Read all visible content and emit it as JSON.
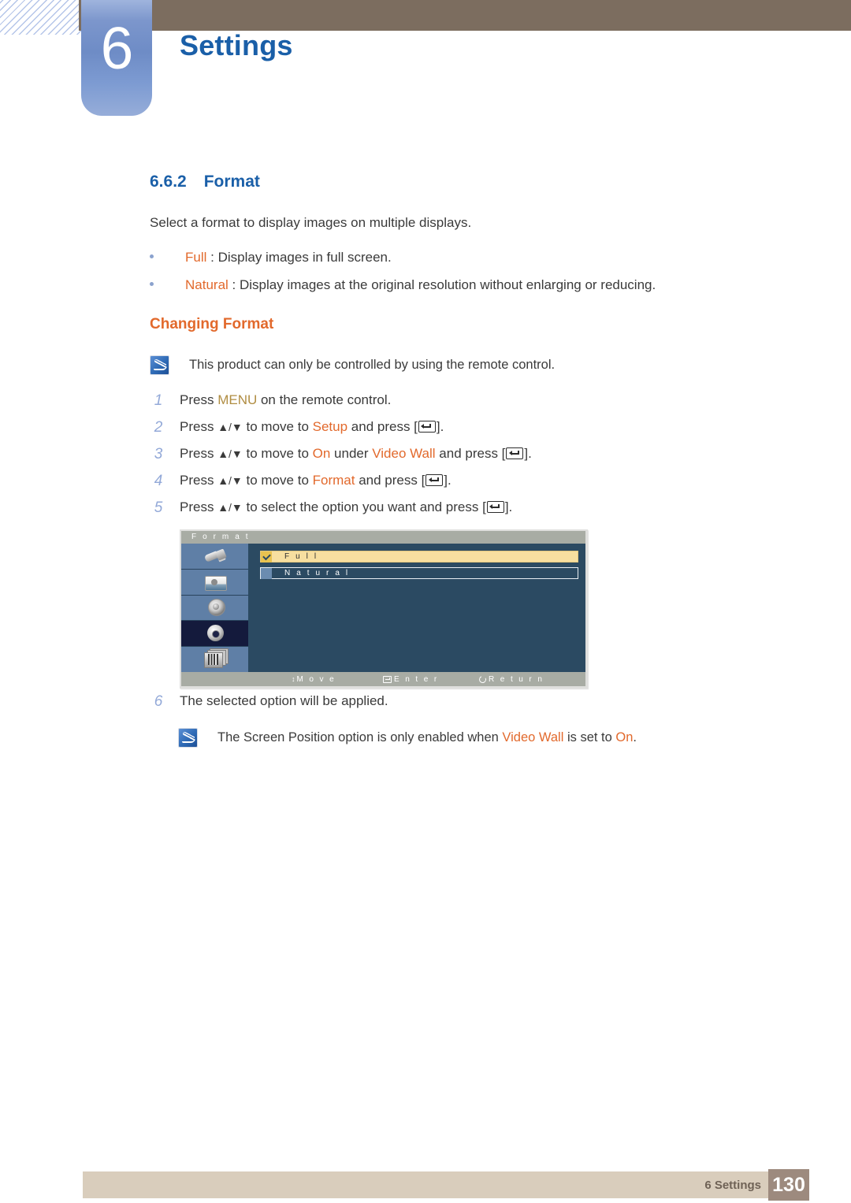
{
  "header": {
    "chapter_number": "6",
    "chapter_title": "Settings"
  },
  "section": {
    "number": "6.6.2",
    "title": "Format",
    "intro": "Select a format to display images on multiple displays."
  },
  "bullets": [
    {
      "term": "Full",
      "rest": " : Display images in full screen."
    },
    {
      "term": "Natural",
      "rest": " : Display images at the original resolution without enlarging or reducing."
    }
  ],
  "subheading": "Changing Format",
  "notes": {
    "note1": "This product can only be controlled by using the remote control.",
    "note2_a": "The Screen Position option is only enabled when ",
    "note2_videowall": "Video Wall",
    "note2_b": " is set to ",
    "note2_on": "On",
    "note2_c": "."
  },
  "steps": {
    "s1": {
      "n": "1",
      "a": "Press ",
      "key": "MENU",
      "b": " on the remote control."
    },
    "s2": {
      "n": "2",
      "a": "Press ",
      "arrows": "▲/▼",
      "b": " to move to ",
      "target": "Setup",
      "c": " and press [",
      "d": "]."
    },
    "s3": {
      "n": "3",
      "a": "Press ",
      "arrows": "▲/▼",
      "b": " to move to ",
      "target": "On",
      "b2": " under ",
      "target2": "Video Wall",
      "c": " and press [",
      "d": "]."
    },
    "s4": {
      "n": "4",
      "a": "Press ",
      "arrows": "▲/▼",
      "b": " to move to ",
      "target": "Format",
      "c": " and press [",
      "d": "]."
    },
    "s5": {
      "n": "5",
      "a": "Press ",
      "arrows": "▲/▼",
      "b": " to select the option you want and press [",
      "d": "]."
    },
    "s6": {
      "n": "6",
      "a": "The selected option will be applied."
    }
  },
  "osd": {
    "title": "F o r m a t",
    "sidebar_icons": [
      "input-plug-icon",
      "picture-icon",
      "sound-speaker-icon",
      "setup-gear-icon",
      "multi-display-icon"
    ],
    "selected_sidebar_index": 3,
    "options": [
      {
        "label": "F u l l",
        "checked": true,
        "highlighted": true
      },
      {
        "label": "N a t u r a l",
        "checked": false,
        "highlighted": false
      }
    ],
    "footer": {
      "move": "M o v e",
      "enter": "E n t e r",
      "return": "R e t u r n"
    }
  },
  "footer": {
    "label": "6 Settings",
    "page": "130"
  },
  "colors": {
    "heading_blue": "#1a5fa8",
    "accent_orange": "#e2692c",
    "key_gold": "#b08d42",
    "brown_bar": "#7c6d5f",
    "footer_tan": "#d9cdbc",
    "page_box": "#9d8a7e",
    "osd_blue": "#2b4a62",
    "osd_highlight": "#f7dfa0"
  }
}
